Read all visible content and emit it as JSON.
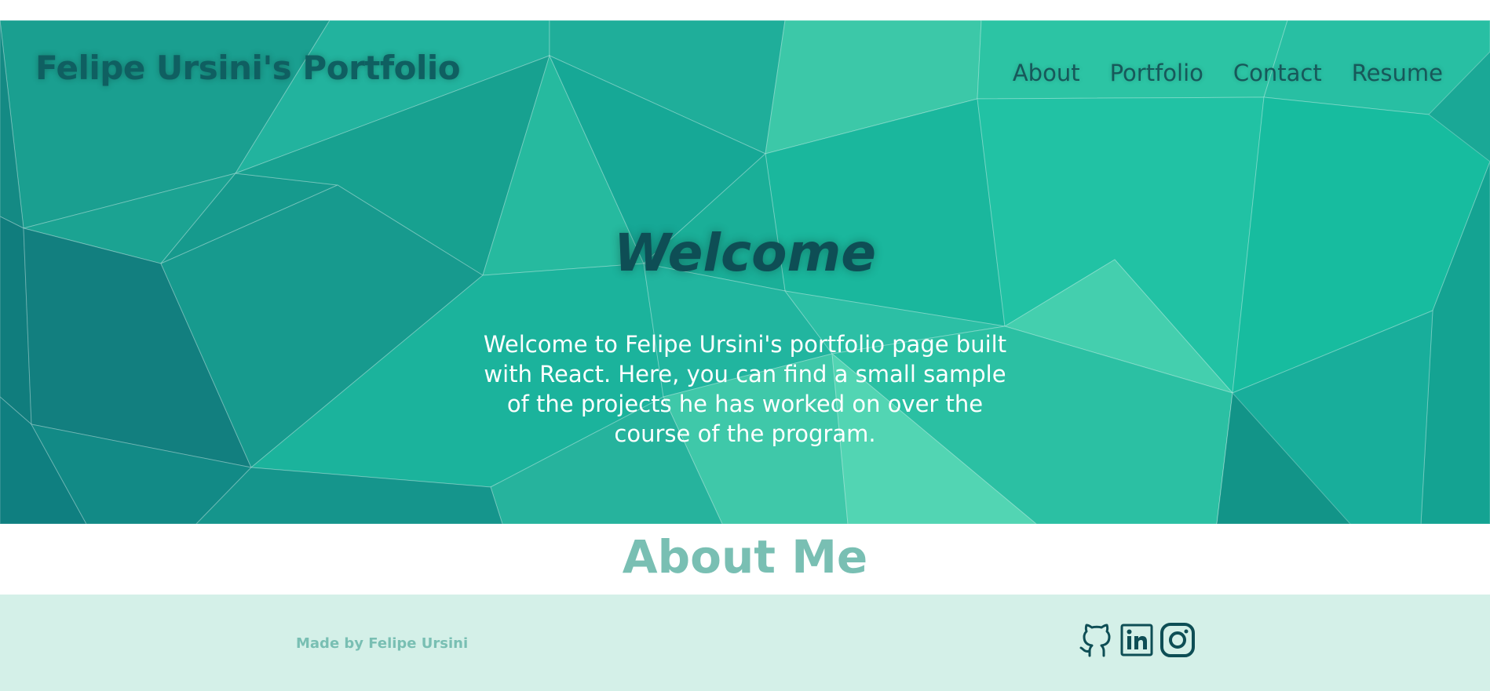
{
  "header": {
    "brand": "Felipe Ursini's Portfolio",
    "nav": [
      {
        "label": "About"
      },
      {
        "label": "Portfolio"
      },
      {
        "label": "Contact"
      },
      {
        "label": "Resume"
      }
    ]
  },
  "hero": {
    "title": "Welcome",
    "text": "Welcome to Felipe Ursini's portfolio page built with React. Here, you can find a small sample of the projects he has worked on over the course of the program."
  },
  "about": {
    "title": "About Me"
  },
  "footer": {
    "credit": "Made by Felipe Ursini",
    "socials": [
      {
        "icon": "github-icon"
      },
      {
        "icon": "linkedin-icon"
      },
      {
        "icon": "instagram-icon"
      }
    ]
  },
  "colors": {
    "hero_base": "#1aa896",
    "brand_text": "#0f5f61",
    "accent": "#79bfb3",
    "footer_bg": "#d4f0e8",
    "icon": "#0e4e55"
  }
}
